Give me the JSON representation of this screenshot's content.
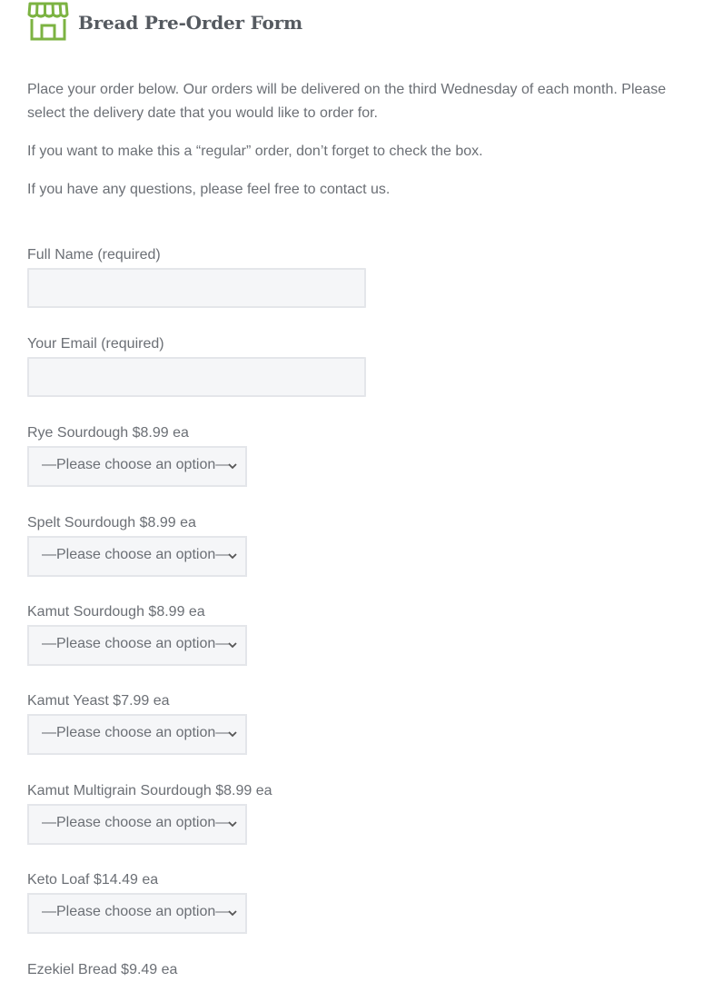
{
  "header": {
    "title": "Bread Pre-Order Form",
    "icon": "store-icon",
    "accent_color": "#7cb342"
  },
  "intro": {
    "paragraph1": "Place your order below.  Our orders will be delivered on the third Wednesday of each month.  Please select the delivery date that you would like to order for.",
    "paragraph2": "If you want to make this a “regular” order, don’t forget to check the box.",
    "paragraph3": "If you have any questions, please feel free to contact us."
  },
  "form": {
    "full_name": {
      "label": "Full Name (required)",
      "value": ""
    },
    "email": {
      "label": "Your Email (required)",
      "value": ""
    },
    "products": [
      {
        "label": "Rye Sourdough $8.99 ea",
        "selected": "—Please choose an option—"
      },
      {
        "label": "Spelt Sourdough $8.99 ea",
        "selected": "—Please choose an option—"
      },
      {
        "label": "Kamut Sourdough $8.99 ea",
        "selected": "—Please choose an option—"
      },
      {
        "label": "Kamut Yeast $7.99 ea",
        "selected": "—Please choose an option—"
      },
      {
        "label": "Kamut Multigrain Sourdough $8.99 ea",
        "selected": "—Please choose an option—"
      },
      {
        "label": "Keto Loaf $14.49 ea",
        "selected": "—Please choose an option—"
      },
      {
        "label": "Ezekiel Bread $9.49 ea"
      }
    ]
  }
}
